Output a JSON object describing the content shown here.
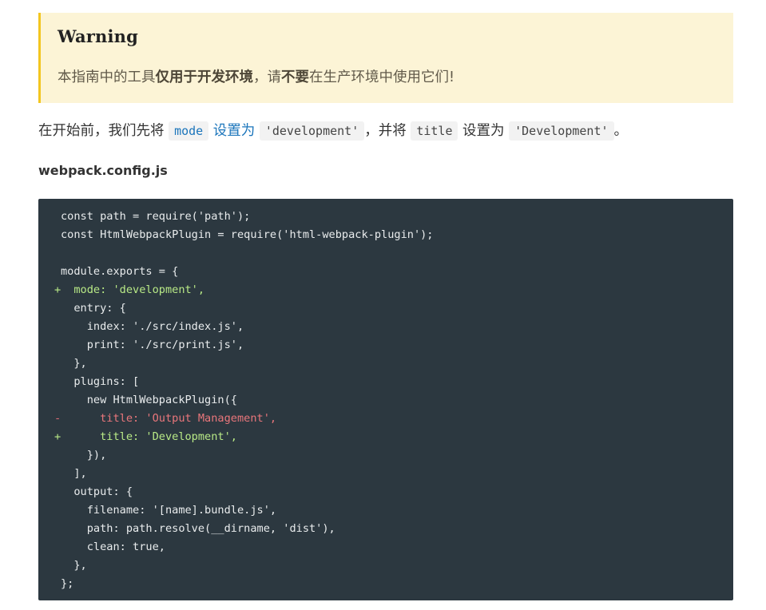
{
  "warning": {
    "title": "Warning",
    "text_1": "本指南中的工具",
    "text_bold_1": "仅用于开发环境",
    "text_2": "，请",
    "text_bold_2": "不要",
    "text_3": "在生产环境中使用它们!"
  },
  "intro": {
    "t1": "在开始前，我们先将 ",
    "code_mode": "mode",
    "link_text": " 设置为",
    "t2": " ",
    "code_development": "'development'",
    "t3": "，并将 ",
    "code_title": "title",
    "t4": " 设置为 ",
    "code_Development": "'Development'",
    "t5": "。"
  },
  "filename": "webpack.config.js",
  "code": {
    "lines": [
      {
        "marker": " ",
        "type": "normal",
        "text": "const path = require('path');"
      },
      {
        "marker": " ",
        "type": "normal",
        "text": "const HtmlWebpackPlugin = require('html-webpack-plugin');"
      },
      {
        "marker": " ",
        "type": "blank",
        "text": ""
      },
      {
        "marker": " ",
        "type": "normal",
        "text": "module.exports = {"
      },
      {
        "marker": "+",
        "type": "add",
        "text": "  mode: 'development',"
      },
      {
        "marker": " ",
        "type": "normal",
        "text": "  entry: {"
      },
      {
        "marker": " ",
        "type": "normal",
        "text": "    index: './src/index.js',"
      },
      {
        "marker": " ",
        "type": "normal",
        "text": "    print: './src/print.js',"
      },
      {
        "marker": " ",
        "type": "normal",
        "text": "  },"
      },
      {
        "marker": " ",
        "type": "normal",
        "text": "  plugins: ["
      },
      {
        "marker": " ",
        "type": "normal",
        "text": "    new HtmlWebpackPlugin({"
      },
      {
        "marker": "-",
        "type": "del",
        "text": "      title: 'Output Management',"
      },
      {
        "marker": "+",
        "type": "add",
        "text": "      title: 'Development',"
      },
      {
        "marker": " ",
        "type": "normal",
        "text": "    }),"
      },
      {
        "marker": " ",
        "type": "normal",
        "text": "  ],"
      },
      {
        "marker": " ",
        "type": "normal",
        "text": "  output: {"
      },
      {
        "marker": " ",
        "type": "normal",
        "text": "    filename: '[name].bundle.js',"
      },
      {
        "marker": " ",
        "type": "normal",
        "text": "    path: path.resolve(__dirname, 'dist'),"
      },
      {
        "marker": " ",
        "type": "normal",
        "text": "    clean: true,"
      },
      {
        "marker": " ",
        "type": "normal",
        "text": "  },"
      },
      {
        "marker": " ",
        "type": "normal",
        "text": "};"
      }
    ]
  }
}
